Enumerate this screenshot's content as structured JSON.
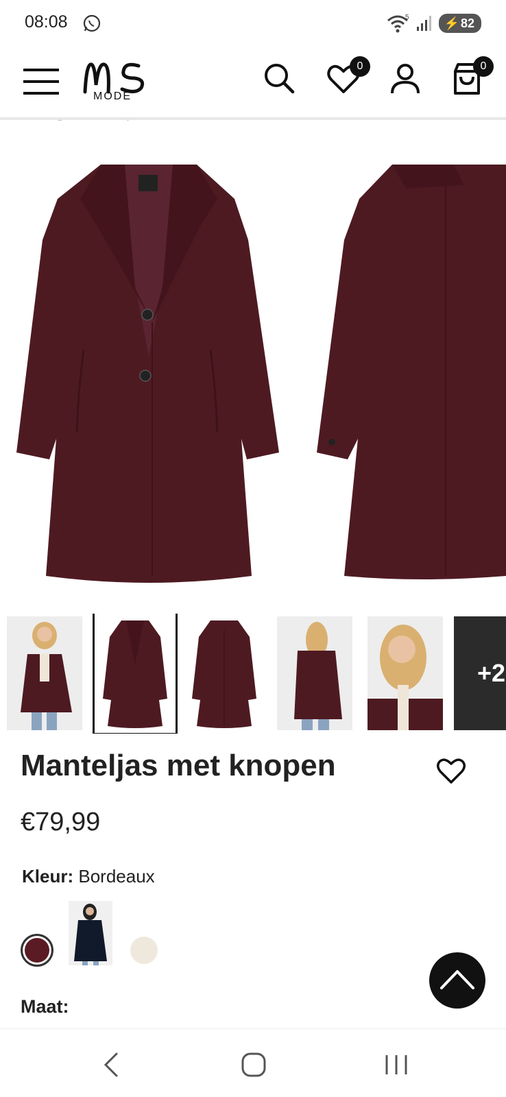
{
  "status_bar": {
    "time": "08:08",
    "battery": "82",
    "wifi_label": "5"
  },
  "header": {
    "logo_ms": "MS",
    "logo_mode": "MODE",
    "wishlist_count": "0",
    "cart_count": "0"
  },
  "breadcrumb": "Terug   Jassen  |  Jassen",
  "product": {
    "title": "Manteljas met knopen",
    "price": "€79,99",
    "color_label": "Kleur:",
    "color_value": "Bordeaux",
    "size_label": "Maat:",
    "more_images": "+2",
    "coat_color": "#4e1a22",
    "coat_shade": "#3e1219"
  },
  "icons": {
    "menu": "hamburger-icon",
    "search": "search-icon",
    "wishlist": "heart-icon",
    "account": "user-icon",
    "cart": "shopping-bag-icon",
    "scroll_top": "chevron-up-icon"
  }
}
